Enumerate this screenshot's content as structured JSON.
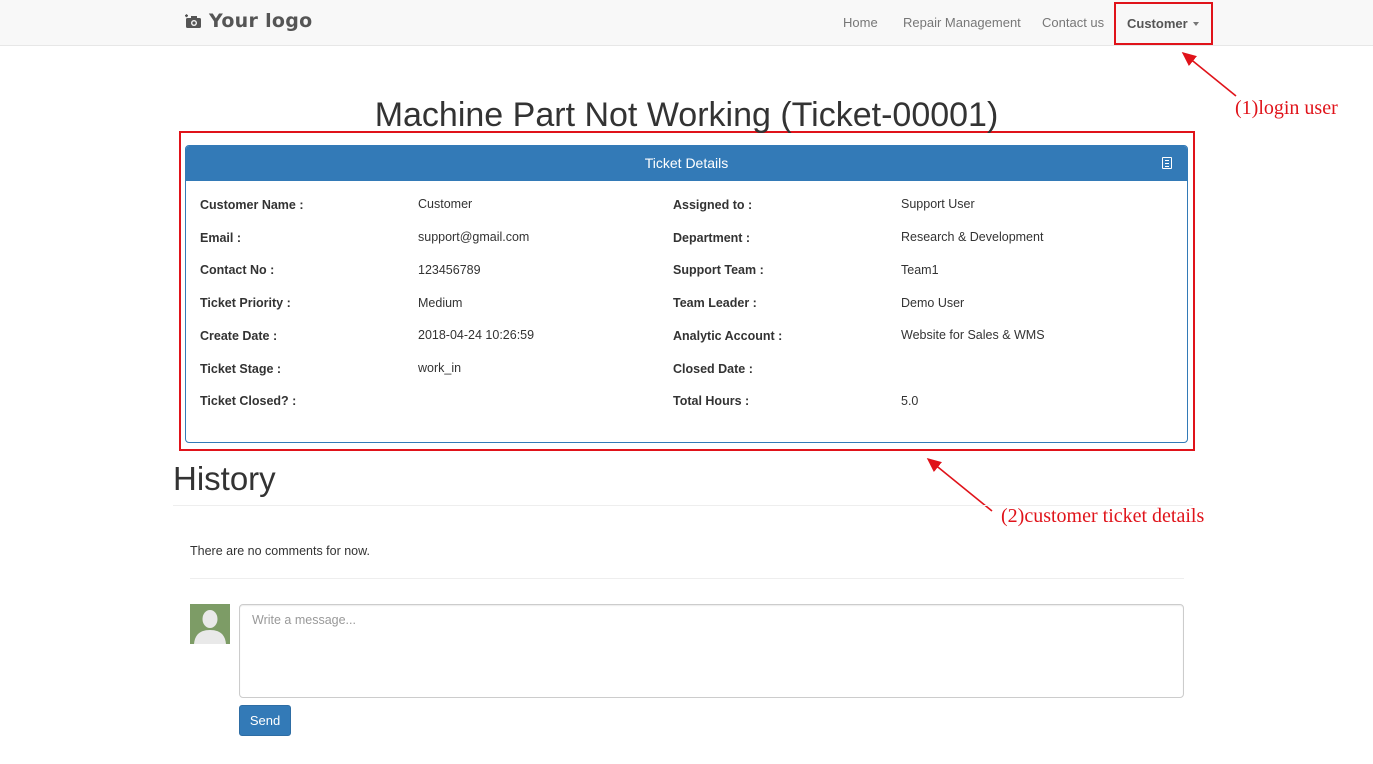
{
  "navbar": {
    "logo_text": "Your logo",
    "items": [
      "Home",
      "Repair Management",
      "Contact us"
    ],
    "user_menu": "Customer"
  },
  "annotations": {
    "login_user": "(1)login user",
    "ticket_details": "(2)customer ticket details",
    "color": "#e0131a"
  },
  "page_title": "Machine Part Not Working (Ticket-00001)",
  "panel": {
    "heading": "Ticket Details",
    "left": [
      {
        "label": "Customer Name :",
        "value": "Customer"
      },
      {
        "label": "Email :",
        "value": "support@gmail.com"
      },
      {
        "label": "Contact No :",
        "value": "123456789"
      },
      {
        "label": "Ticket Priority :",
        "value": "Medium"
      },
      {
        "label": "Create Date :",
        "value": "2018-04-24 10:26:59"
      },
      {
        "label": "Ticket Stage :",
        "value": "work_in"
      },
      {
        "label": "Ticket Closed? :",
        "value": ""
      }
    ],
    "right": [
      {
        "label": "Assigned to :",
        "value": "Support User"
      },
      {
        "label": "Department :",
        "value": "Research & Development"
      },
      {
        "label": "Support Team :",
        "value": "Team1"
      },
      {
        "label": "Team Leader :",
        "value": "Demo User"
      },
      {
        "label": "Analytic Account :",
        "value": "Website for Sales & WMS"
      },
      {
        "label": "Closed Date :",
        "value": ""
      },
      {
        "label": "Total Hours :",
        "value": "5.0"
      }
    ]
  },
  "history": {
    "title": "History",
    "empty_text": "There are no comments for now.",
    "message_placeholder": "Write a message...",
    "send_label": "Send"
  },
  "colors": {
    "primary": "#337ab7",
    "annotation_red": "#e0131a"
  }
}
